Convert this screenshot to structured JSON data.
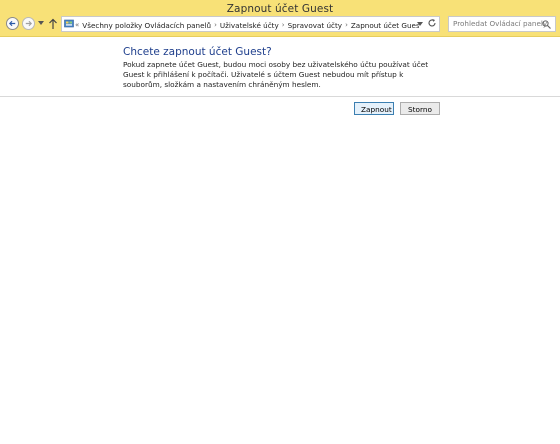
{
  "window": {
    "title": "Zapnout účet Guest"
  },
  "navigation": {
    "breadcrumb_overflow": "«",
    "breadcrumb": [
      "Všechny položky Ovládacích panelů",
      "Uživatelské účty",
      "Spravovat účty",
      "Zapnout účet Guest"
    ],
    "search_placeholder": "Prohledat Ovládací panely"
  },
  "main": {
    "heading": "Chcete zapnout účet Guest?",
    "description": "Pokud zapnete účet Guest, budou moci osoby bez uživatelského účtu používat účet Guest k přihlášení k počítači. Uživatelé s účtem Guest nebudou mít přístup k souborům, složkám a nastavením chráněným heslem."
  },
  "actions": {
    "enable_label": "Zapnout",
    "cancel_label": "Storno"
  },
  "colors": {
    "titlebar": "#f8e177",
    "heading": "#1e3e8c",
    "primary_button_border": "#3c7fb1"
  },
  "icons": [
    "back-arrow-icon",
    "forward-arrow-icon",
    "history-dropdown-icon",
    "up-arrow-icon",
    "control-panel-icon",
    "address-dropdown-icon",
    "refresh-icon",
    "search-icon"
  ]
}
